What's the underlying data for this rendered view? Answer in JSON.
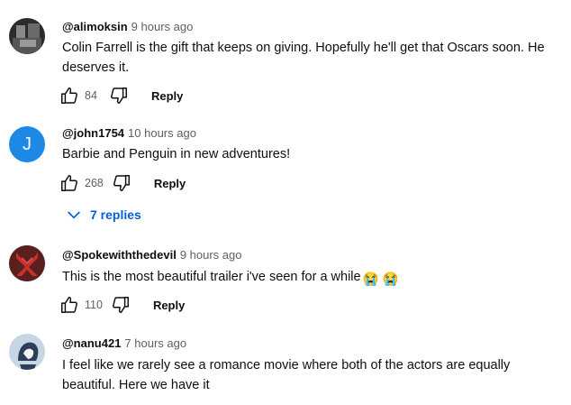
{
  "comments": [
    {
      "author": "@alimoksin",
      "time": "9 hours ago",
      "text": "Colin Farrell is the gift that keeps on giving. Hopefully he'll get that Oscars soon. He deserves it.",
      "likes": "84",
      "reply_label": "Reply"
    },
    {
      "author": "@john1754",
      "time": "10 hours ago",
      "avatar_letter": "J",
      "text": "Barbie and Penguin in new adventures!",
      "likes": "268",
      "reply_label": "Reply",
      "replies_label": "7 replies"
    },
    {
      "author": "@Spokewiththedevil",
      "time": "9 hours ago",
      "text": "This is the most beautiful trailer i've seen for a while",
      "emoji": "😭 😭",
      "likes": "110",
      "reply_label": "Reply"
    },
    {
      "author": "@nanu421",
      "time": "7 hours ago",
      "text": "I feel like we rarely see a romance movie where both of the actors are equally beautiful. Here we have it"
    }
  ],
  "colors": {
    "link": "#065fd4",
    "text": "#0f0f0f",
    "secondary": "#606060",
    "avatar_blue": "#1e88e5"
  },
  "icons": {
    "like": "thumbs-up-outline",
    "dislike": "thumbs-down-outline",
    "expand": "chevron-down"
  }
}
